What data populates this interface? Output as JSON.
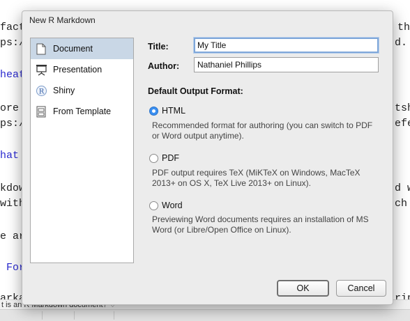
{
  "background": {
    "lines": [
      {
        "text": "fact",
        "blue": false
      },
      {
        "text": "ps:/",
        "blue": false
      },
      {
        "text": "heat",
        "blue": true
      },
      {
        "text": "ore ",
        "blue": false
      },
      {
        "text": "ps:/",
        "blue": false
      },
      {
        "text": "hat ",
        "blue": true
      },
      {
        "text": "kdow",
        "blue": false
      },
      {
        "text": "with",
        "blue": false
      },
      {
        "text": "e ar",
        "blue": false
      },
      {
        "text": " For",
        "blue": true
      },
      {
        "text": "arka",
        "blue": false
      }
    ],
    "right_fragments": [
      "th",
      "d.",
      "tsh",
      "efe",
      "d w",
      "ch",
      "rip"
    ],
    "status_text": "t is an R Markdown document? ♢"
  },
  "dialog": {
    "title": "New R Markdown",
    "sidebar": [
      {
        "label": "Document",
        "icon": "document-icon"
      },
      {
        "label": "Presentation",
        "icon": "presentation-icon"
      },
      {
        "label": "Shiny",
        "icon": "shiny-r-icon"
      },
      {
        "label": "From Template",
        "icon": "template-icon"
      }
    ],
    "form": {
      "title_label": "Title:",
      "title_value": "My Title",
      "author_label": "Author:",
      "author_value": "Nathaniel Phillips",
      "output_heading": "Default Output Format:"
    },
    "formats": [
      {
        "label": "HTML",
        "checked": true,
        "desc": "Recommended format for authoring (you can switch to PDF or Word output anytime)."
      },
      {
        "label": "PDF",
        "checked": false,
        "desc": "PDF output requires TeX (MiKTeX on Windows, MacTeX 2013+ on OS X, TeX Live 2013+ on Linux)."
      },
      {
        "label": "Word",
        "checked": false,
        "desc": "Previewing Word documents requires an installation of MS Word (or Libre/Open Office on Linux)."
      }
    ],
    "buttons": {
      "ok": "OK",
      "cancel": "Cancel"
    }
  }
}
